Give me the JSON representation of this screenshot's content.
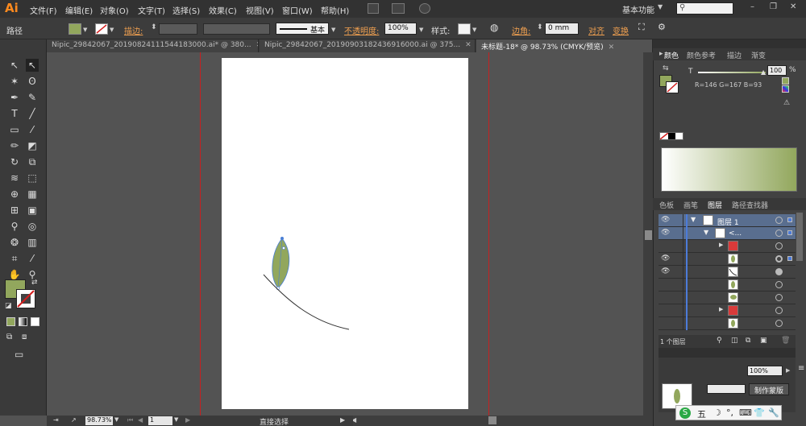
{
  "app": {
    "logo": "Ai"
  },
  "menu": [
    "文件(F)",
    "编辑(E)",
    "对象(O)",
    "文字(T)",
    "选择(S)",
    "效果(C)",
    "视图(V)",
    "窗口(W)",
    "帮助(H)"
  ],
  "workspace": "基本功能",
  "window_buttons": [
    "–",
    "❐",
    "✕"
  ],
  "control_bar": {
    "selection_label": "路径",
    "fill_color": "#92a75d",
    "stroke_label": "描边:",
    "stroke_style": "基本",
    "opacity_label": "不透明度:",
    "opacity_value": "100%",
    "style_label": "样式:",
    "corner_label": "边角:",
    "corner_value": "0 mm",
    "align_label": "对齐",
    "transform_label": "变换"
  },
  "tabs": [
    {
      "label": "Nipic_29842067_20190824111544183000.ai* @ 380...",
      "active": false
    },
    {
      "label": "Nipic_29842067_20190903182436916000.ai @ 375...",
      "active": false
    },
    {
      "label": "未标题-18* @ 98.73% (CMYK/预览)",
      "active": true
    }
  ],
  "tab_close": "✕",
  "status_bar": {
    "zoom": "98.73%",
    "artboard": "1",
    "tool_name": "直接选择"
  },
  "color_panel": {
    "tabs": [
      "颜色",
      "颜色参考",
      "描边",
      "渐变"
    ],
    "t_label": "T",
    "t_value": "100",
    "rgb_text": "R=146 G=167 B=93",
    "color": "#92a75d"
  },
  "layers_panel": {
    "tabs": [
      "色板",
      "画笔",
      "图层",
      "路径查找器"
    ],
    "layer_name": "图层 1",
    "sublayer_name": "<...",
    "footer": "1 个图层"
  },
  "lower_panel": {
    "mask_button": "制作蒙版",
    "percent": "100%"
  },
  "ime": [
    "S",
    "五",
    "☽",
    "°,",
    "⌨",
    "👕",
    "🔧"
  ]
}
